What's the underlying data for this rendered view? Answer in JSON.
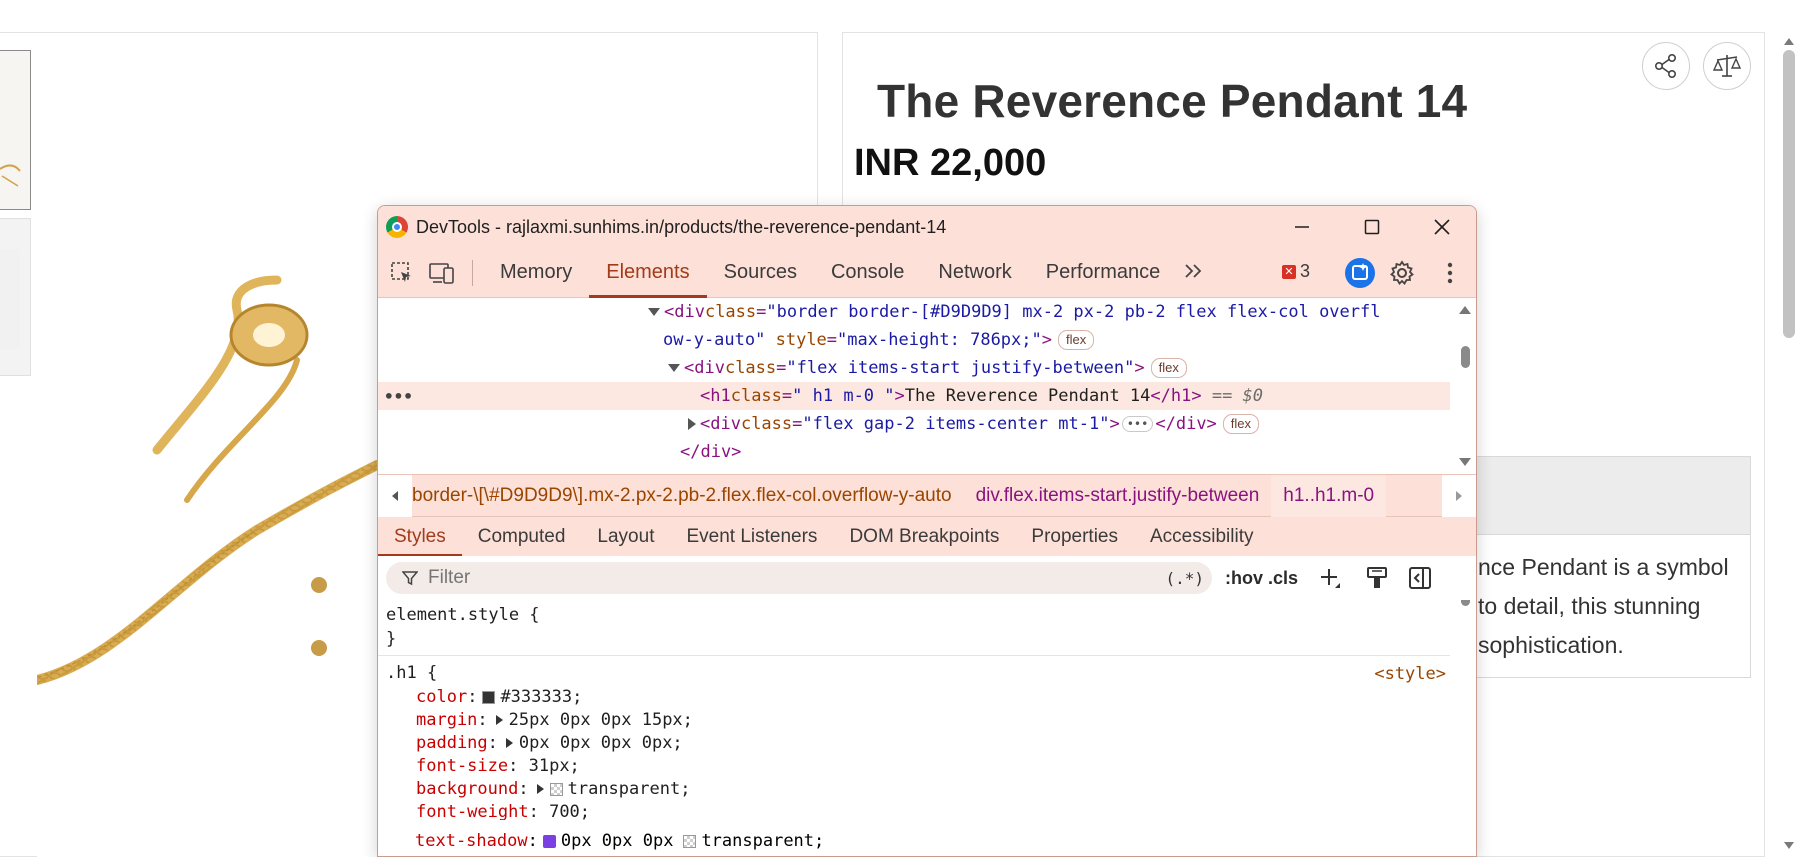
{
  "page": {
    "product_title": "The Reverence Pendant 14",
    "price": "INR 22,000",
    "description_lines": [
      "nce Pendant is a symbol",
      " to detail, this stunning",
      "sophistication."
    ],
    "icons": [
      "share-icon",
      "compare-scale-icon"
    ]
  },
  "devtools": {
    "title": "DevTools - rajlaxmi.sunhims.in/products/the-reverence-pendant-14",
    "controls": {
      "minimize": "—",
      "maximize": "☐",
      "close": "✕"
    },
    "tabs": [
      {
        "label": "Memory",
        "active": false
      },
      {
        "label": "Elements",
        "active": true
      },
      {
        "label": "Sources",
        "active": false
      },
      {
        "label": "Console",
        "active": false
      },
      {
        "label": "Network",
        "active": false
      },
      {
        "label": "Performance",
        "active": false
      }
    ],
    "more_tabs": "»",
    "error_count": "3",
    "dom": {
      "line1_attr_val": "\"border border-[#D9D9D9] mx-2  px-2 pb-2 flex flex-col overfl",
      "line2_wrap": "ow-y-auto\"",
      "line2_style_val": "\"max-height: 786px;\"",
      "line3_class_val": "\"flex items-start justify-between\"",
      "line4_class_val": "\" h1 m-0 \"",
      "line4_text": "The Reverence Pendant 14",
      "line4_dollar": "== $0",
      "line5_class_val": "\"flex gap-2 items-center  mt-1\"",
      "line6_close": "</div>",
      "chip_flex": "flex"
    },
    "breadcrumbs": [
      {
        "text": "border-\\[\\#D9D9D9\\].mx-2.px-2.pb-2.flex.flex-col.overflow-y-auto",
        "selected": false
      },
      {
        "text": "div.flex.items-start.justify-between",
        "selected": false
      },
      {
        "text": "h1..h1.m-0",
        "selected": true
      }
    ],
    "sub_tabs": [
      {
        "label": "Styles",
        "active": true
      },
      {
        "label": "Computed",
        "active": false
      },
      {
        "label": "Layout",
        "active": false
      },
      {
        "label": "Event Listeners",
        "active": false
      },
      {
        "label": "DOM Breakpoints",
        "active": false
      },
      {
        "label": "Properties",
        "active": false
      },
      {
        "label": "Accessibility",
        "active": false
      }
    ],
    "filter": {
      "placeholder": "Filter",
      "regex": "(.*)",
      "hov": ":hov",
      "cls": ".cls"
    },
    "styles": {
      "element_style": "element.style {",
      "close_brace": "}",
      "rule_selector": ".h1 {",
      "source": "<style>",
      "props": [
        {
          "name": "color",
          "value": "#333333",
          "swatch": "#333333"
        },
        {
          "name": "margin",
          "value": "25px 0px 0px 15px;",
          "expand": true
        },
        {
          "name": "padding",
          "value": "0px 0px 0px 0px;",
          "expand": true
        },
        {
          "name": "font-size",
          "value": "31px;"
        },
        {
          "name": "background",
          "value": "transparent;",
          "expand": true,
          "checker": true
        },
        {
          "name": "font-weight",
          "value": "700;"
        },
        {
          "name": "text-shadow",
          "value": "0px 0px 0px",
          "extra": "transparent;"
        }
      ]
    }
  },
  "colors": {
    "devtools_bg": "#fde1d8",
    "accent": "#a23b1c",
    "tag": "#881280",
    "attr": "#994500",
    "value": "#1a1aa6",
    "heading": "#333333"
  }
}
